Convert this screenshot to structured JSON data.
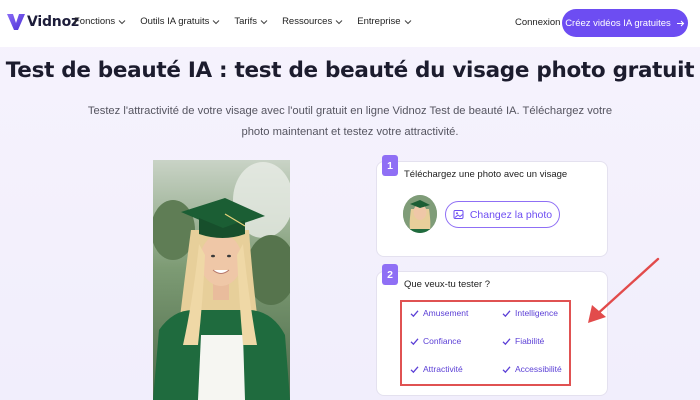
{
  "nav": {
    "logo_text": "Vidnoz",
    "menu": [
      {
        "label": "Fonctions"
      },
      {
        "label": "Outils IA gratuits"
      },
      {
        "label": "Tarifs"
      },
      {
        "label": "Ressources"
      },
      {
        "label": "Entreprise"
      }
    ],
    "login": "Connexion",
    "cta": "Créez vidéos IA gratuites",
    "cta_icon": "arrow-right-icon"
  },
  "hero": {
    "title": "Test de beauté IA : test de beauté du visage photo gratuit",
    "subtitle": "Testez l'attractivité de votre visage avec l'outil gratuit en ligne Vidnoz Test de beauté IA. Téléchargez votre photo maintenant et testez votre attractivité."
  },
  "step1": {
    "number": "1",
    "label": "Téléchargez une photo avec un visage",
    "button": "Changez la photo",
    "button_icon": "image-icon"
  },
  "step2": {
    "number": "2",
    "label": "Que veux-tu tester ?",
    "options": [
      {
        "label": "Amusement",
        "checked": true
      },
      {
        "label": "Intelligence",
        "checked": true
      },
      {
        "label": "Confiance",
        "checked": true
      },
      {
        "label": "Fiabilité",
        "checked": true
      },
      {
        "label": "Attractivité",
        "checked": true
      },
      {
        "label": "Accessibilité",
        "checked": true
      }
    ]
  },
  "colors": {
    "brand": "#6d4df2",
    "badge": "#8f6ff5",
    "highlight": "#e05252"
  }
}
